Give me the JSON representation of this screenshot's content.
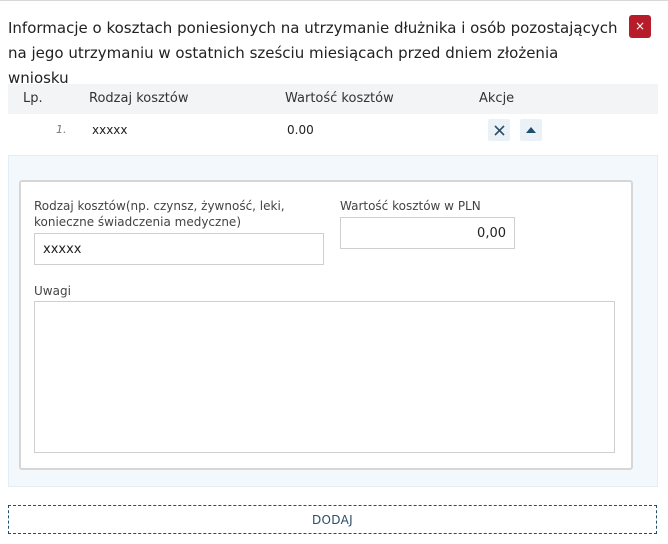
{
  "section": {
    "title": "Informacje o kosztach poniesionych na utrzymanie dłużnika i osób pozostających na jego utrzymaniu w ostatnich sześciu miesiącach przed dniem złożenia wniosku",
    "close_label": "×"
  },
  "table": {
    "headers": {
      "lp": "Lp.",
      "type": "Rodzaj kosztów",
      "value": "Wartość kosztów",
      "actions": "Akcje"
    },
    "rows": [
      {
        "lp": "1.",
        "type": "xxxxx",
        "value": "0.00"
      }
    ]
  },
  "form": {
    "cost_type_label": "Rodzaj kosztów(np. czynsz, żywność, leki, konieczne świadczenia medyczne)",
    "cost_type_value": "xxxxx",
    "cost_value_label": "Wartość kosztów w PLN",
    "cost_value_value": "0,00",
    "notes_label": "Uwagi",
    "notes_value": ""
  },
  "add_button_label": "DODAJ",
  "colors": {
    "close_button": "#b71c2a",
    "accent": "#1f4f6b",
    "header_bg": "#f2f4f6",
    "panel_bg": "#f3f8fc"
  },
  "icons": {
    "remove_row": "close-icon",
    "collapse_row": "caret-up-icon"
  }
}
